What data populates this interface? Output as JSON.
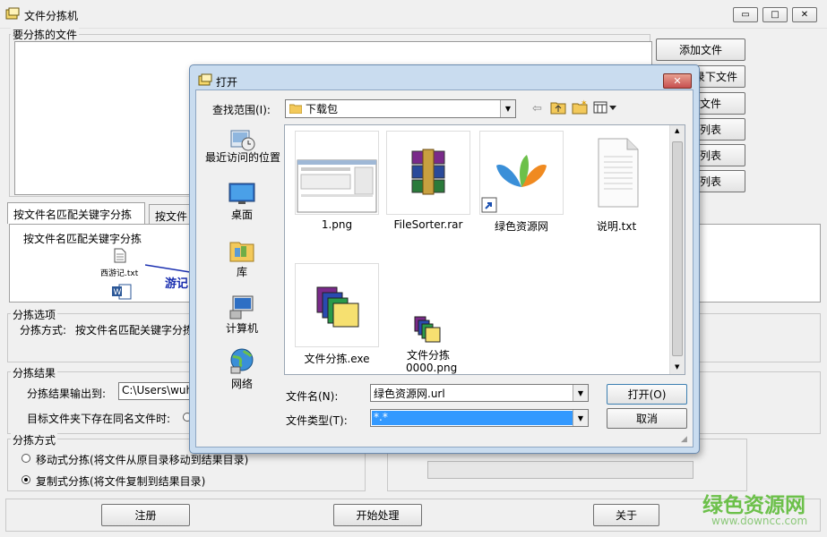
{
  "window": {
    "title": "文件分拣机"
  },
  "files_group": {
    "label": "要分拣的文件"
  },
  "side_buttons": [
    "添加文件",
    "录下文件",
    "文件",
    "列表",
    "列表",
    "列表"
  ],
  "tabs": [
    "按文件名匹配关键字分拣",
    "按文件"
  ],
  "tab_content": {
    "heading": "按文件名匹配关键字分拣",
    "file1": "西游记.txt",
    "keyword": "游记"
  },
  "options_group": {
    "label": "分拣选项",
    "mode_label": "分拣方式:",
    "mode_value": "按文件名匹配关键字分拣"
  },
  "result_group": {
    "label": "分拣结果",
    "output_label": "分拣结果输出到:",
    "output_value": "C:\\Users\\wuha",
    "conflict_label": "目标文件夹下存在同名文件时:"
  },
  "method_group": {
    "label": "分拣方式",
    "move_label": "移动式分拣(将文件从原目录移动到结果目录)",
    "copy_label": "复制式分拣(将文件复制到结果目录)"
  },
  "bottom_buttons": {
    "register": "注册",
    "start": "开始处理",
    "about": "关于"
  },
  "dialog": {
    "title": "打开",
    "lookin_label": "查找范围(I):",
    "lookin_value": "下载包",
    "places": [
      "最近访问的位置",
      "桌面",
      "库",
      "计算机",
      "网络"
    ],
    "files": [
      "1.png",
      "FileSorter.rar",
      "绿色资源网",
      "说明.txt",
      "文件分拣.exe",
      "文件分拣0000.png"
    ],
    "filename_label": "文件名(N):",
    "filename_value": "绿色资源网.url",
    "filetype_label": "文件类型(T):",
    "filetype_value": "*.*",
    "open_button": "打开(O)",
    "cancel_button": "取消"
  },
  "watermark": {
    "line1": "绿色资源网",
    "line2": "www.downcc.com"
  },
  "colors": {
    "title_bar": "#f0f0f0",
    "dialog_frame": "#c9dcef",
    "close_button": "#c75050",
    "selection": "#3399ff",
    "watermark": "#6cc04a"
  }
}
